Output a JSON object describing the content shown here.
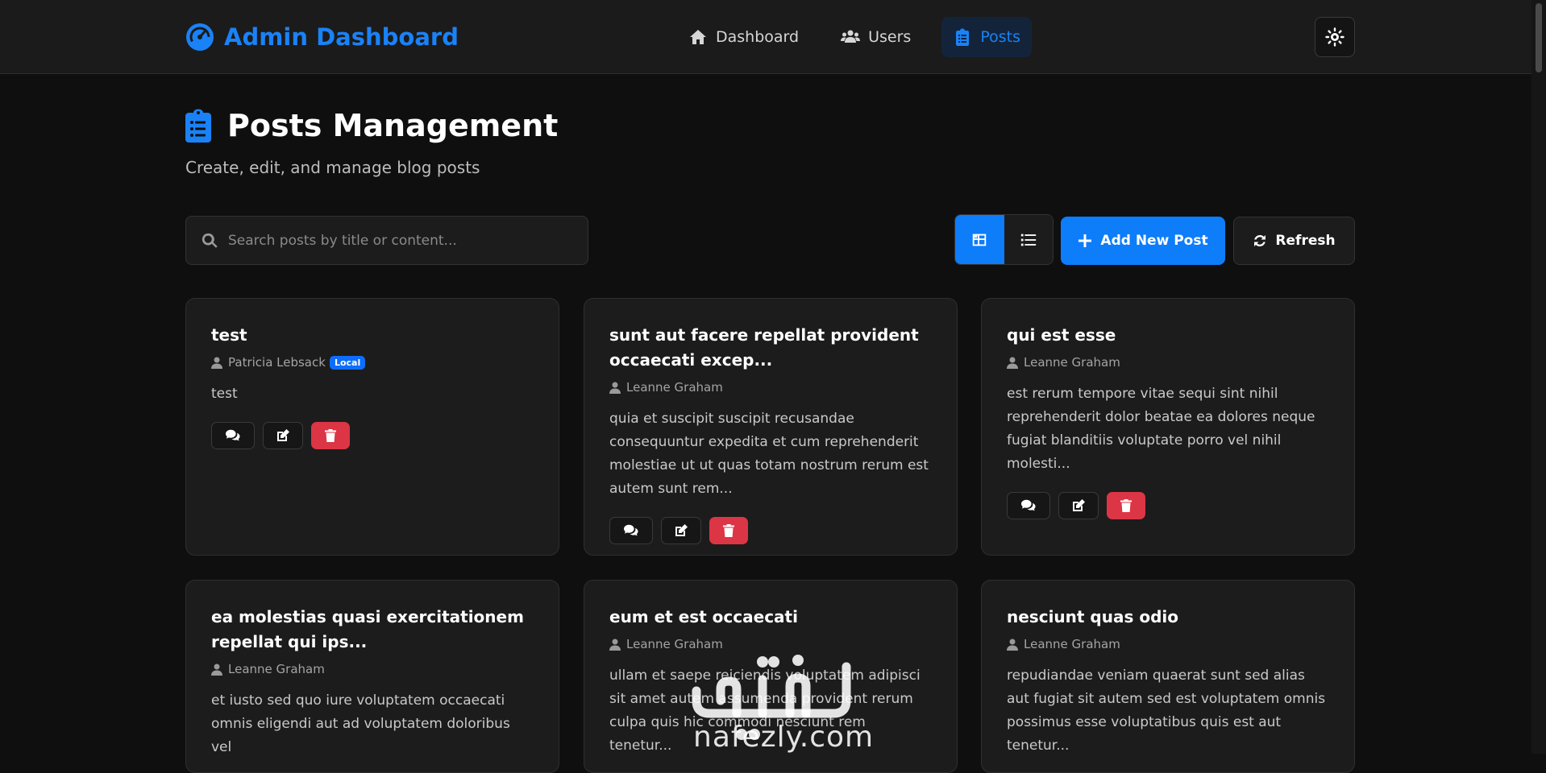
{
  "brand": {
    "title": "Admin Dashboard",
    "accent": "#1a82f7"
  },
  "nav": [
    {
      "label": "Dashboard",
      "icon": "home-icon",
      "active": false
    },
    {
      "label": "Users",
      "icon": "users-icon",
      "active": false
    },
    {
      "label": "Posts",
      "icon": "clipboard-icon",
      "active": true
    }
  ],
  "header": {
    "title": "Posts Management",
    "subtitle": "Create, edit, and manage blog posts"
  },
  "toolbar": {
    "search_placeholder": "Search posts by title or content...",
    "add_label": "Add New Post",
    "refresh_label": "Refresh",
    "view_mode": "grid"
  },
  "posts": [
    {
      "title": "test",
      "author": "Patricia Lebsack",
      "badge": "Local",
      "body": "test"
    },
    {
      "title": "sunt aut facere repellat provident occaecati excep...",
      "author": "Leanne Graham",
      "body": "quia et suscipit suscipit recusandae consequuntur expedita et cum reprehenderit molestiae ut ut quas totam nostrum rerum est autem sunt rem..."
    },
    {
      "title": "qui est esse",
      "author": "Leanne Graham",
      "body": "est rerum tempore vitae sequi sint nihil reprehenderit dolor beatae ea dolores neque fugiat blanditiis voluptate porro vel nihil molesti..."
    },
    {
      "title": "ea molestias quasi exercitationem repellat qui ips...",
      "author": "Leanne Graham",
      "body": "et iusto sed quo iure voluptatem occaecati omnis eligendi aut ad voluptatem doloribus vel"
    },
    {
      "title": "eum et est occaecati",
      "author": "Leanne Graham",
      "body": "ullam et saepe reiciendis voluptatem adipisci sit amet autem assumenda provident rerum culpa quis hic commodi nesciunt rem tenetur..."
    },
    {
      "title": "nesciunt quas odio",
      "author": "Leanne Graham",
      "body": "repudiandae veniam quaerat sunt sed alias aut fugiat sit autem sed est voluptatem omnis possimus esse voluptatibus quis est aut tenetur..."
    }
  ],
  "watermark": {
    "text": "nafezly.com"
  },
  "colors": {
    "primary": "#0d7dfa",
    "danger": "#dc3545",
    "background": "#0f0f0f",
    "card": "#1c1c1c"
  }
}
